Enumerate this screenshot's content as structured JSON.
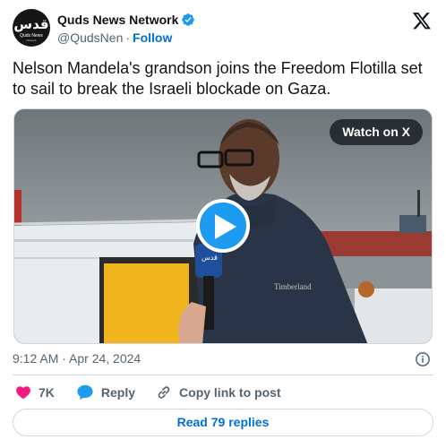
{
  "author": {
    "logo_text": "قدس",
    "logo_sub": "Quds News",
    "logo_sub2": "Network",
    "display_name": "Quds News Network",
    "handle": "@QudsNen",
    "separator": "·",
    "follow_label": "Follow"
  },
  "tweet": {
    "text": "Nelson Mandela's grandson joins the Freedom Flotilla set to sail to break the Israeli blockade on Gaza.",
    "timestamp": "9:12 AM · Apr 24, 2024"
  },
  "media": {
    "watch_label": "Watch on X",
    "jacket_text": "Timberland",
    "mic_text": "قدس"
  },
  "actions": {
    "like_count": "7K",
    "reply_label": "Reply",
    "copy_label": "Copy link to post"
  },
  "read_replies_label": "Read 79 replies",
  "colors": {
    "verified": "#1d9bf0",
    "like": "#f91880",
    "reply": "#1d9bf0",
    "link": "#006fd6",
    "play_button": "#1d9bf0"
  },
  "icons": {
    "brand": "x-logo-icon",
    "verified": "verified-badge-icon",
    "info": "info-icon",
    "like": "heart-icon",
    "reply": "speech-bubble-icon",
    "copy": "link-icon",
    "play": "play-icon"
  }
}
